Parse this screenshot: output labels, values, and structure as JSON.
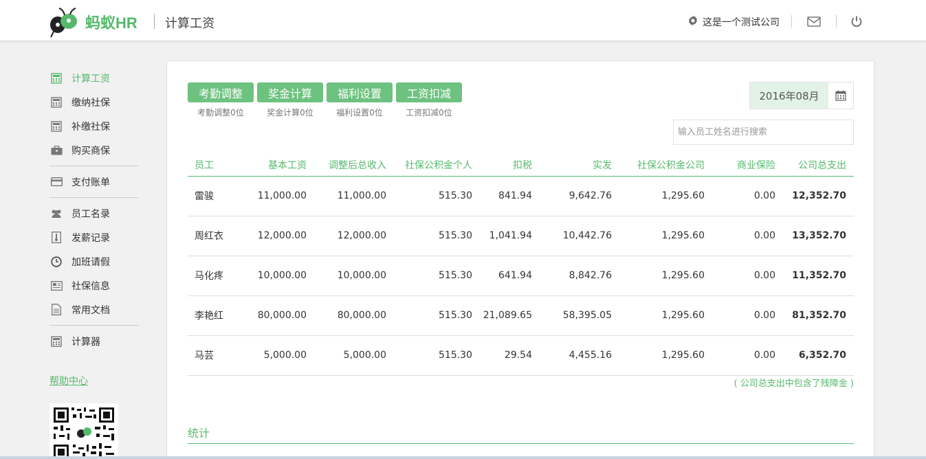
{
  "header": {
    "logo_text": "蚂蚁HR",
    "page_title": "计算工资",
    "company": "这是一个测试公司",
    "icons": [
      "gear-icon",
      "mail-icon",
      "power-icon"
    ]
  },
  "sidebar": {
    "items": [
      {
        "label": "计算工资",
        "icon": "calculator-icon",
        "active": true
      },
      {
        "label": "缴纳社保",
        "icon": "calculator-icon"
      },
      {
        "label": "补缴社保",
        "icon": "calculator-icon"
      },
      {
        "label": "购买商保",
        "icon": "briefcase-icon"
      },
      {
        "label": "支付账单",
        "icon": "credit-card-icon"
      },
      {
        "label": "员工名录",
        "icon": "users-icon"
      },
      {
        "label": "发薪记录",
        "icon": "thermometer-icon"
      },
      {
        "label": "加班请假",
        "icon": "clock-icon"
      },
      {
        "label": "社保信息",
        "icon": "newspaper-icon"
      },
      {
        "label": "常用文档",
        "icon": "document-icon"
      },
      {
        "label": "计算器",
        "icon": "calculator-icon"
      }
    ],
    "help_link": "帮助中心"
  },
  "toolbar": {
    "tabs": [
      {
        "label": "考勤调整",
        "sub": "考勤调整0位"
      },
      {
        "label": "奖金计算",
        "sub": "奖金计算0位"
      },
      {
        "label": "福利设置",
        "sub": "福利设置0位"
      },
      {
        "label": "工资扣减",
        "sub": "工资扣减0位"
      }
    ],
    "month": "2016年08月",
    "search_placeholder": "输入员工姓名进行搜索"
  },
  "table": {
    "columns": [
      "员工",
      "基本工资",
      "调整后总收入",
      "社保公积金个人",
      "扣税",
      "实发",
      "社保公积金公司",
      "商业保险",
      "公司总支出"
    ],
    "rows": [
      [
        "雷骏",
        "11,000.00",
        "11,000.00",
        "515.30",
        "841.94",
        "9,642.76",
        "1,295.60",
        "0.00",
        "12,352.70"
      ],
      [
        "周红衣",
        "12,000.00",
        "12,000.00",
        "515.30",
        "1,041.94",
        "10,442.76",
        "1,295.60",
        "0.00",
        "13,352.70"
      ],
      [
        "马化疼",
        "10,000.00",
        "10,000.00",
        "515.30",
        "641.94",
        "8,842.76",
        "1,295.60",
        "0.00",
        "11,352.70"
      ],
      [
        "李艳红",
        "80,000.00",
        "80,000.00",
        "515.30",
        "21,089.65",
        "58,395.05",
        "1,295.60",
        "0.00",
        "81,352.70"
      ],
      [
        "马芸",
        "5,000.00",
        "5,000.00",
        "515.30",
        "29.54",
        "4,455.16",
        "1,295.60",
        "0.00",
        "6,352.70"
      ]
    ],
    "note": "( 公司总支出中包含了残障金 )"
  },
  "stats": {
    "title": "统计"
  },
  "colors": {
    "accent": "#55b96b",
    "button": "#6cc27e",
    "date_bg": "#e3f2e6"
  }
}
